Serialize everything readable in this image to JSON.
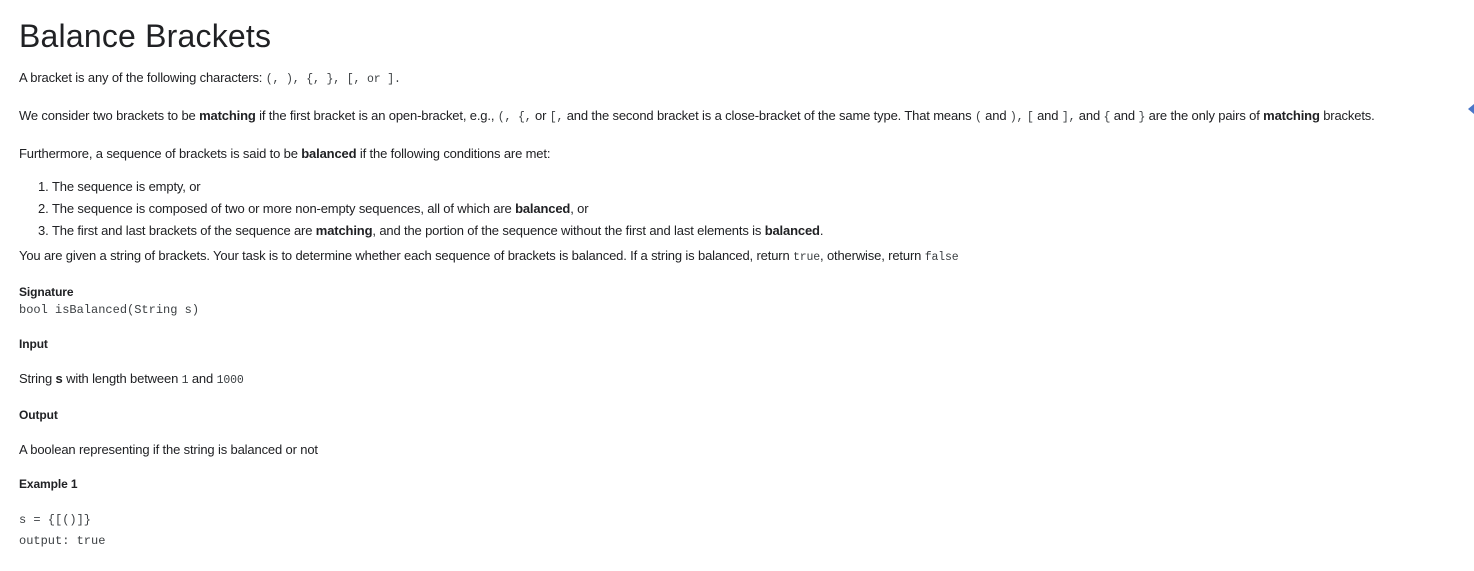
{
  "title": "Balance Brackets",
  "intro": {
    "prefix": "A bracket is any of the following characters: ",
    "chars": "(, ), {, }, [, or ].",
    "suffix": ""
  },
  "matching_para": {
    "t1": "We consider two brackets to be ",
    "b1": "matching",
    "t2": " if the first bracket is an open-bracket, e.g., ",
    "c1": "(, {,",
    "t3": " or ",
    "c2": "[,",
    "t4": " and the second bracket is a close-bracket of the same type. That means ",
    "c3": "(",
    "t5": " and ",
    "c4": "),",
    "t6": " ",
    "c5": "[",
    "t7": " and ",
    "c6": "],",
    "t8": " and ",
    "c7": "{",
    "t9": " and ",
    "c8": "}",
    "t10": " are the only pairs of ",
    "b2": "matching",
    "t11": " brackets."
  },
  "balanced_para": {
    "t1": "Furthermore, a sequence of brackets is said to be ",
    "b1": "balanced",
    "t2": " if the following conditions are met:"
  },
  "conditions": [
    {
      "t1": "The sequence is empty, or",
      "b": "",
      "t2": ""
    },
    {
      "t1": "The sequence is composed of two or more non-empty sequences, all of which are ",
      "b": "balanced",
      "t2": ", or"
    },
    {
      "t1": "The first and last brackets of the sequence are ",
      "b": "matching",
      "t2": ", and the portion of the sequence without the first and last elements is ",
      "b2": "balanced",
      "t3": "."
    }
  ],
  "task_para": {
    "t1": "You are given a string of brackets. Your task is to determine whether each sequence of brackets is balanced. If a string is balanced, return ",
    "c1": "true",
    "t2": ", otherwise, return ",
    "c2": "false"
  },
  "signature": {
    "heading": "Signature",
    "code": "bool isBalanced(String s)"
  },
  "input": {
    "heading": "Input",
    "t1": "String ",
    "b1": "s",
    "t2": " with length between ",
    "c1": "1",
    "t3": " and ",
    "c2": "1000"
  },
  "output": {
    "heading": "Output",
    "text": "A boolean representing if the string is balanced or not"
  },
  "example1": {
    "heading": "Example 1",
    "line1": "s = {[()]}",
    "line2": "output: true"
  }
}
